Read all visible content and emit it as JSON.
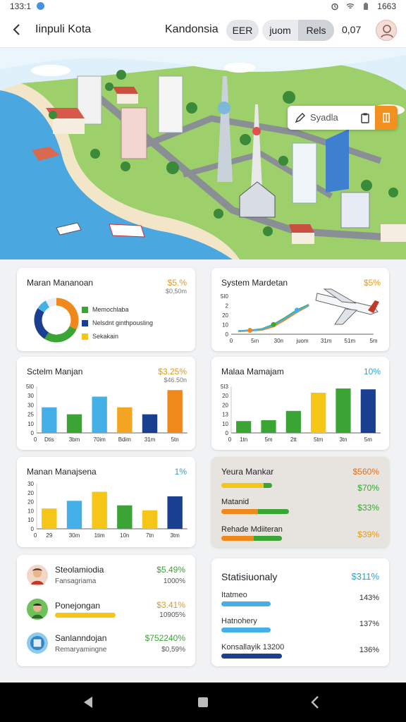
{
  "status_bar": {
    "time": "133:1",
    "battery": "1663"
  },
  "app_bar": {
    "title": "Iinpuli Kota",
    "region": "Kandonsia",
    "chip_label": "EER",
    "segments": [
      "juom",
      "Rels"
    ],
    "value": "0,07"
  },
  "map_search": {
    "text": "Syadla"
  },
  "colors": {
    "green": "#3aa535",
    "navy": "#1b3f8f",
    "orange": "#f0891b",
    "blue": "#45b0e8",
    "yellow": "#f5c518",
    "teal": "#29a4c8",
    "gold": "#e59a16"
  },
  "cards": {
    "donut": {
      "title": "Maran Mananoan",
      "value": "$5.%",
      "sub": "$0,50m",
      "legend": [
        {
          "label": "Memochlaba",
          "color": "#3aa535"
        },
        {
          "label": "Nelsdnt ginthpousling",
          "color": "#1b3f8f"
        },
        {
          "label": "Sekakain",
          "color": "#f5c518"
        }
      ]
    },
    "line": {
      "title": "System Mardetan",
      "value": "$5%"
    },
    "bar1": {
      "title": "Sctelm Manjan",
      "value": "$3.25%",
      "sub": "$46.50n"
    },
    "bar2": {
      "title": "Malaa Mamajam",
      "value": "10%"
    },
    "bar3": {
      "title": "Manan Manajsena",
      "value": "1%"
    },
    "progress": {
      "title": "Yeura Mankar",
      "items": [
        {
          "label": "",
          "value": "$560%",
          "value_color": "#e0701a"
        },
        {
          "label": "",
          "value": "$70%",
          "value_color": "#3aa535"
        },
        {
          "label": "Matanid",
          "value": "$33%",
          "value_color": "#3aa535"
        },
        {
          "label": "Rehade Mdiiteran",
          "value": "$39%",
          "value_color": "#e59a16"
        }
      ]
    },
    "people": [
      {
        "name": "Steolamiodia",
        "sub": "Fansagriama",
        "value": "$5.49%",
        "value2": "1000%",
        "value_color": "#3aa535"
      },
      {
        "name": "Ponejongan",
        "sub": "",
        "value": "$3.41%",
        "value2": "10905%",
        "value_color": "#e59a16"
      },
      {
        "name": "Sanlanndojan",
        "sub": "Remaryamingne",
        "value": "$752240%",
        "value2": "$0,59%",
        "value_color": "#3aa535"
      }
    ],
    "stats": {
      "title": "Statisiuonaly",
      "value": "$311%",
      "items": [
        {
          "label": "Itatmeo",
          "value": "143%",
          "color": "#45b0e8",
          "fill": 0.42
        },
        {
          "label": "Hatnohery",
          "value": "137%",
          "color": "#45b0e8",
          "fill": 0.42
        },
        {
          "label": "Konsallayik 13200",
          "value": "136%",
          "color": "#1b3f8f",
          "fill": 0.52
        }
      ]
    }
  },
  "chart_data": [
    {
      "type": "pie",
      "title": "Maran Mananoan",
      "values": [
        32,
        27,
        25,
        8,
        8
      ],
      "colors": [
        "#f0891b",
        "#3aa535",
        "#1b3f8f",
        "#45b0e8",
        "#e8eef3"
      ]
    },
    {
      "type": "line",
      "title": "System Mardetan",
      "x": [
        "0",
        "5ın",
        "30n",
        "juom",
        "31m",
        "51m",
        "5m"
      ],
      "yticks": [
        "5I0",
        "2",
        "20",
        "10",
        "0"
      ],
      "series": [
        {
          "color": "#3aa535",
          "values": [
            1,
            3,
            7,
            20,
            40,
            62,
            78
          ]
        },
        {
          "color": "#f0891b",
          "values": [
            0,
            2,
            4,
            14,
            34,
            56,
            75
          ]
        },
        {
          "color": "#45b0e8",
          "values": [
            1,
            3,
            6,
            18,
            38,
            60,
            76
          ]
        }
      ],
      "ylim": [
        0,
        100
      ]
    },
    {
      "type": "bar",
      "title": "Sctelm Manjan",
      "categories": [
        "Dtis",
        "3bm",
        "70im",
        "Bdim",
        "31m",
        "5tn"
      ],
      "xticks": [
        "0",
        "Dtis",
        "3bm",
        "70im",
        "Bdim",
        "31m",
        "5tn"
      ],
      "yticks": [
        "5I0",
        "30",
        "30",
        "25",
        "10",
        "0"
      ],
      "values": [
        55,
        40,
        78,
        55,
        40,
        92
      ],
      "colors": [
        "#45b0e8",
        "#3aa535",
        "#45b0e8",
        "#f5a524",
        "#1b3f8f",
        "#f0891b"
      ],
      "ylim": [
        0,
        100
      ]
    },
    {
      "type": "bar",
      "title": "Malaa Mamajam",
      "categories": [
        "1tn",
        "5m",
        "2tt",
        "5tm",
        "3tn",
        "5m"
      ],
      "xticks": [
        "0",
        "1tn",
        "5m",
        "2tt",
        "5tm",
        "3tn",
        "5m"
      ],
      "yticks": [
        "5I3",
        "20",
        "20",
        "13",
        "10",
        "0"
      ],
      "values": [
        28,
        30,
        52,
        95,
        105,
        103
      ],
      "colors": [
        "#3aa535",
        "#3aa535",
        "#3aa535",
        "#f5c518",
        "#3aa535",
        "#1b3f8f"
      ],
      "ylim": [
        0,
        110
      ]
    },
    {
      "type": "bar",
      "title": "Manan Manajsena",
      "categories": [
        "29",
        "30m",
        "1tim",
        "10n",
        "7tn",
        "3tm"
      ],
      "xticks": [
        "0",
        "29",
        "30m",
        "1tim",
        "10n",
        "7tn",
        "3tm"
      ],
      "yticks": [
        "30",
        "20",
        "20",
        "10",
        "10",
        "0"
      ],
      "values": [
        45,
        62,
        82,
        52,
        41,
        72
      ],
      "colors": [
        "#f5c518",
        "#45b0e8",
        "#f5c518",
        "#3aa535",
        "#f5c518",
        "#1b3f8f"
      ],
      "ylim": [
        0,
        100
      ]
    }
  ]
}
